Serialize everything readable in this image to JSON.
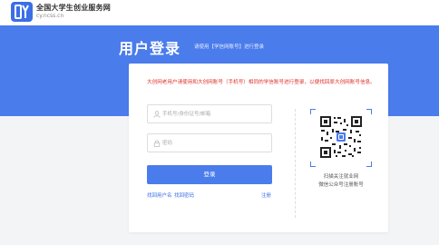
{
  "header": {
    "brand_title": "全国大学生创业服务网",
    "brand_url": "cy.ncss.cn",
    "logo_icon": "cy-logo-icon"
  },
  "banner": {
    "title": "用户登录",
    "note": "请使用【学信网账号】进行登录"
  },
  "login": {
    "notice": "大创网老用户请使用和大创网账号（手机号）相同的学信账号进行登录，以便找回原大创网账号信息。",
    "username_placeholder": "手机号/身份证号/邮箱",
    "password_placeholder": "密码",
    "login_label": "登录",
    "retrieve_username": "找回用户名",
    "retrieve_password": "找回密码",
    "register": "注册"
  },
  "qr": {
    "caption_line1": "扫描关注就业网",
    "caption_line2": "微信公众号注册账号"
  },
  "colors": {
    "accent": "#4a7cec",
    "notice": "#e0302a",
    "link": "#3c6ee6"
  }
}
